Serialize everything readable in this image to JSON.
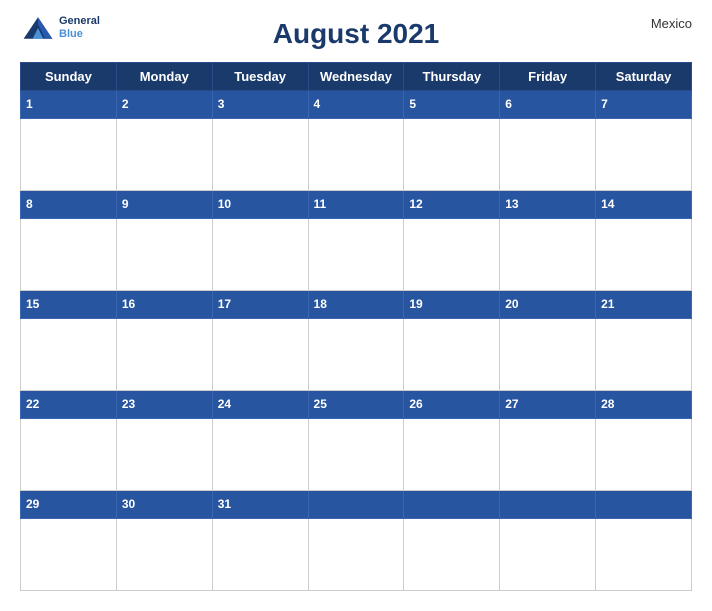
{
  "header": {
    "brand_general": "General",
    "brand_blue": "Blue",
    "title": "August 2021",
    "country": "Mexico"
  },
  "days_of_week": [
    "Sunday",
    "Monday",
    "Tuesday",
    "Wednesday",
    "Thursday",
    "Friday",
    "Saturday"
  ],
  "weeks": [
    {
      "dates": [
        1,
        2,
        3,
        4,
        5,
        6,
        7
      ]
    },
    {
      "dates": [
        8,
        9,
        10,
        11,
        12,
        13,
        14
      ]
    },
    {
      "dates": [
        15,
        16,
        17,
        18,
        19,
        20,
        21
      ]
    },
    {
      "dates": [
        22,
        23,
        24,
        25,
        26,
        27,
        28
      ]
    },
    {
      "dates": [
        29,
        30,
        31,
        null,
        null,
        null,
        null
      ]
    }
  ],
  "colors": {
    "header_bg": "#1a3a6b",
    "row_label_bg": "#2855a0",
    "text_white": "#ffffff",
    "text_dark": "#1a3a6b",
    "border": "#cccccc"
  }
}
